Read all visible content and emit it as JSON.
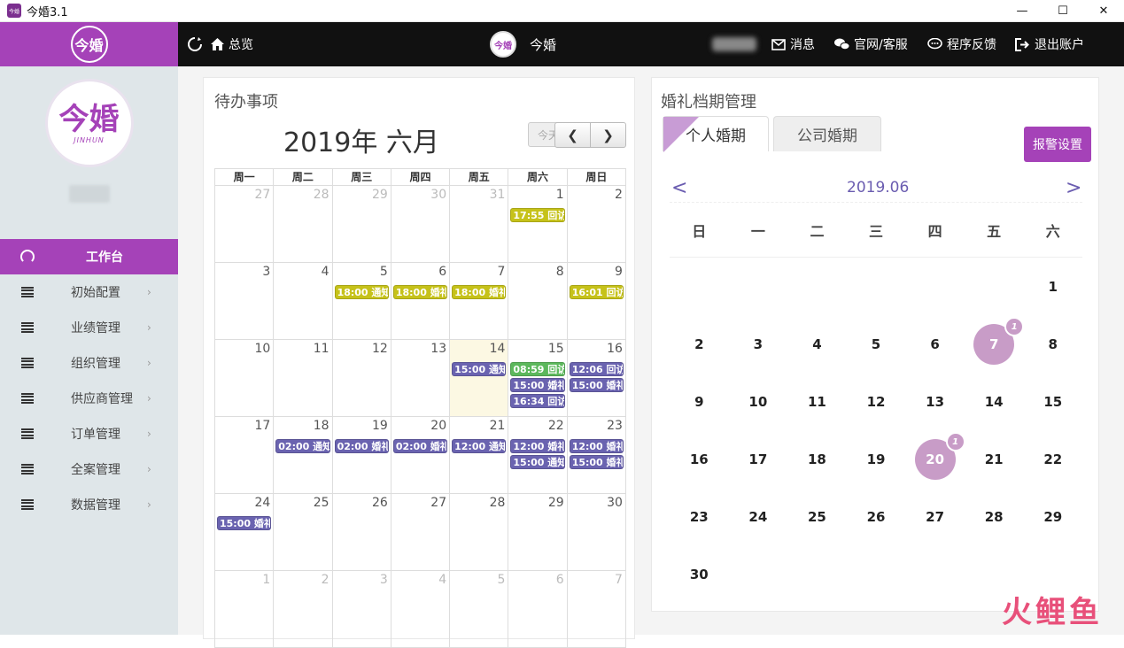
{
  "window": {
    "title": "今婚3.1",
    "app_icon_text": "今婚"
  },
  "sidebar": {
    "logo_text": "今婚",
    "avatar_text": "今婚",
    "avatar_sub": "JINHUN",
    "items": [
      {
        "label": "工作台",
        "active": true
      },
      {
        "label": "初始配置"
      },
      {
        "label": "业绩管理"
      },
      {
        "label": "组织管理"
      },
      {
        "label": "供应商管理"
      },
      {
        "label": "订单管理"
      },
      {
        "label": "全案管理"
      },
      {
        "label": "数据管理"
      }
    ]
  },
  "topbar": {
    "overview": "总览",
    "center_label": "今婚",
    "logo_text": "今婚",
    "messages": "消息",
    "service": "官网/客服",
    "feedback": "程序反馈",
    "logout": "退出账户"
  },
  "todo": {
    "title": "待办事项",
    "month_title": "2019年 六月",
    "today_btn": "今天",
    "weekdays": [
      "周一",
      "周二",
      "周三",
      "周四",
      "周五",
      "周六",
      "周日"
    ],
    "weeks": [
      [
        {
          "d": "27",
          "o": true
        },
        {
          "d": "28",
          "o": true
        },
        {
          "d": "29",
          "o": true
        },
        {
          "d": "30",
          "o": true
        },
        {
          "d": "31",
          "o": true
        },
        {
          "d": "1",
          "ev": [
            {
              "t": "17:55 回访",
              "c": "#c6c21a"
            }
          ]
        },
        {
          "d": "2"
        }
      ],
      [
        {
          "d": "3"
        },
        {
          "d": "4"
        },
        {
          "d": "5",
          "ev": [
            {
              "t": "18:00 通知",
              "c": "#c6c21a"
            }
          ]
        },
        {
          "d": "6",
          "ev": [
            {
              "t": "18:00 婚礼",
              "c": "#c6c21a"
            }
          ]
        },
        {
          "d": "7",
          "ev": [
            {
              "t": "18:00 婚礼",
              "c": "#c6c21a"
            }
          ]
        },
        {
          "d": "8"
        },
        {
          "d": "9",
          "ev": [
            {
              "t": "16:01 回访",
              "c": "#c6c21a"
            }
          ]
        }
      ],
      [
        {
          "d": "10"
        },
        {
          "d": "11"
        },
        {
          "d": "12"
        },
        {
          "d": "13"
        },
        {
          "d": "14",
          "today": true,
          "ev": [
            {
              "t": "15:00 通知",
              "c": "#6a63b0"
            }
          ]
        },
        {
          "d": "15",
          "ev": [
            {
              "t": "08:59 回访",
              "c": "#5cb85c"
            },
            {
              "t": "15:00 婚礼",
              "c": "#6a63b0"
            },
            {
              "t": "16:34 回访",
              "c": "#6a63b0"
            }
          ]
        },
        {
          "d": "16",
          "ev": [
            {
              "t": "12:06 回访",
              "c": "#6a63b0"
            },
            {
              "t": "15:00 婚礼",
              "c": "#6a63b0"
            }
          ]
        }
      ],
      [
        {
          "d": "17"
        },
        {
          "d": "18",
          "ev": [
            {
              "t": "02:00 通知",
              "c": "#6a63b0"
            }
          ]
        },
        {
          "d": "19",
          "ev": [
            {
              "t": "02:00 婚礼",
              "c": "#6a63b0"
            }
          ]
        },
        {
          "d": "20",
          "ev": [
            {
              "t": "02:00 婚礼",
              "c": "#6a63b0"
            }
          ]
        },
        {
          "d": "21",
          "ev": [
            {
              "t": "12:00 通知",
              "c": "#6a63b0"
            }
          ]
        },
        {
          "d": "22",
          "ev": [
            {
              "t": "12:00 婚礼",
              "c": "#6a63b0"
            },
            {
              "t": "15:00 通知",
              "c": "#6a63b0"
            }
          ]
        },
        {
          "d": "23",
          "ev": [
            {
              "t": "12:00 婚礼",
              "c": "#6a63b0"
            },
            {
              "t": "15:00 婚礼",
              "c": "#6a63b0"
            }
          ]
        }
      ],
      [
        {
          "d": "24",
          "ev": [
            {
              "t": "15:00 婚礼",
              "c": "#6a63b0"
            }
          ]
        },
        {
          "d": "25"
        },
        {
          "d": "26"
        },
        {
          "d": "27"
        },
        {
          "d": "28"
        },
        {
          "d": "29"
        },
        {
          "d": "30"
        }
      ],
      [
        {
          "d": "1",
          "o": true
        },
        {
          "d": "2",
          "o": true
        },
        {
          "d": "3",
          "o": true
        },
        {
          "d": "4",
          "o": true
        },
        {
          "d": "5",
          "o": true
        },
        {
          "d": "6",
          "o": true
        },
        {
          "d": "7",
          "o": true
        }
      ]
    ]
  },
  "wedding": {
    "title": "婚礼档期管理",
    "tabs": [
      "个人婚期",
      "公司婚期"
    ],
    "alarm_btn": "报警设置",
    "month": "2019.06",
    "prev": "<",
    "next": ">",
    "weekdays": [
      "日",
      "一",
      "二",
      "三",
      "四",
      "五",
      "六"
    ],
    "rows": [
      [
        "",
        "",
        "",
        "",
        "",
        "",
        "1"
      ],
      [
        "2",
        "3",
        "4",
        "5",
        "6",
        "7",
        "8"
      ],
      [
        "9",
        "10",
        "11",
        "12",
        "13",
        "14",
        "15"
      ],
      [
        "16",
        "17",
        "18",
        "19",
        "20",
        "21",
        "22"
      ],
      [
        "23",
        "24",
        "25",
        "26",
        "27",
        "28",
        "29"
      ],
      [
        "30",
        "",
        "",
        "",
        "",
        "",
        ""
      ]
    ],
    "marked": [
      {
        "day": "7",
        "count": "1"
      },
      {
        "day": "20",
        "count": "1"
      }
    ]
  },
  "watermark": "火鲤鱼"
}
